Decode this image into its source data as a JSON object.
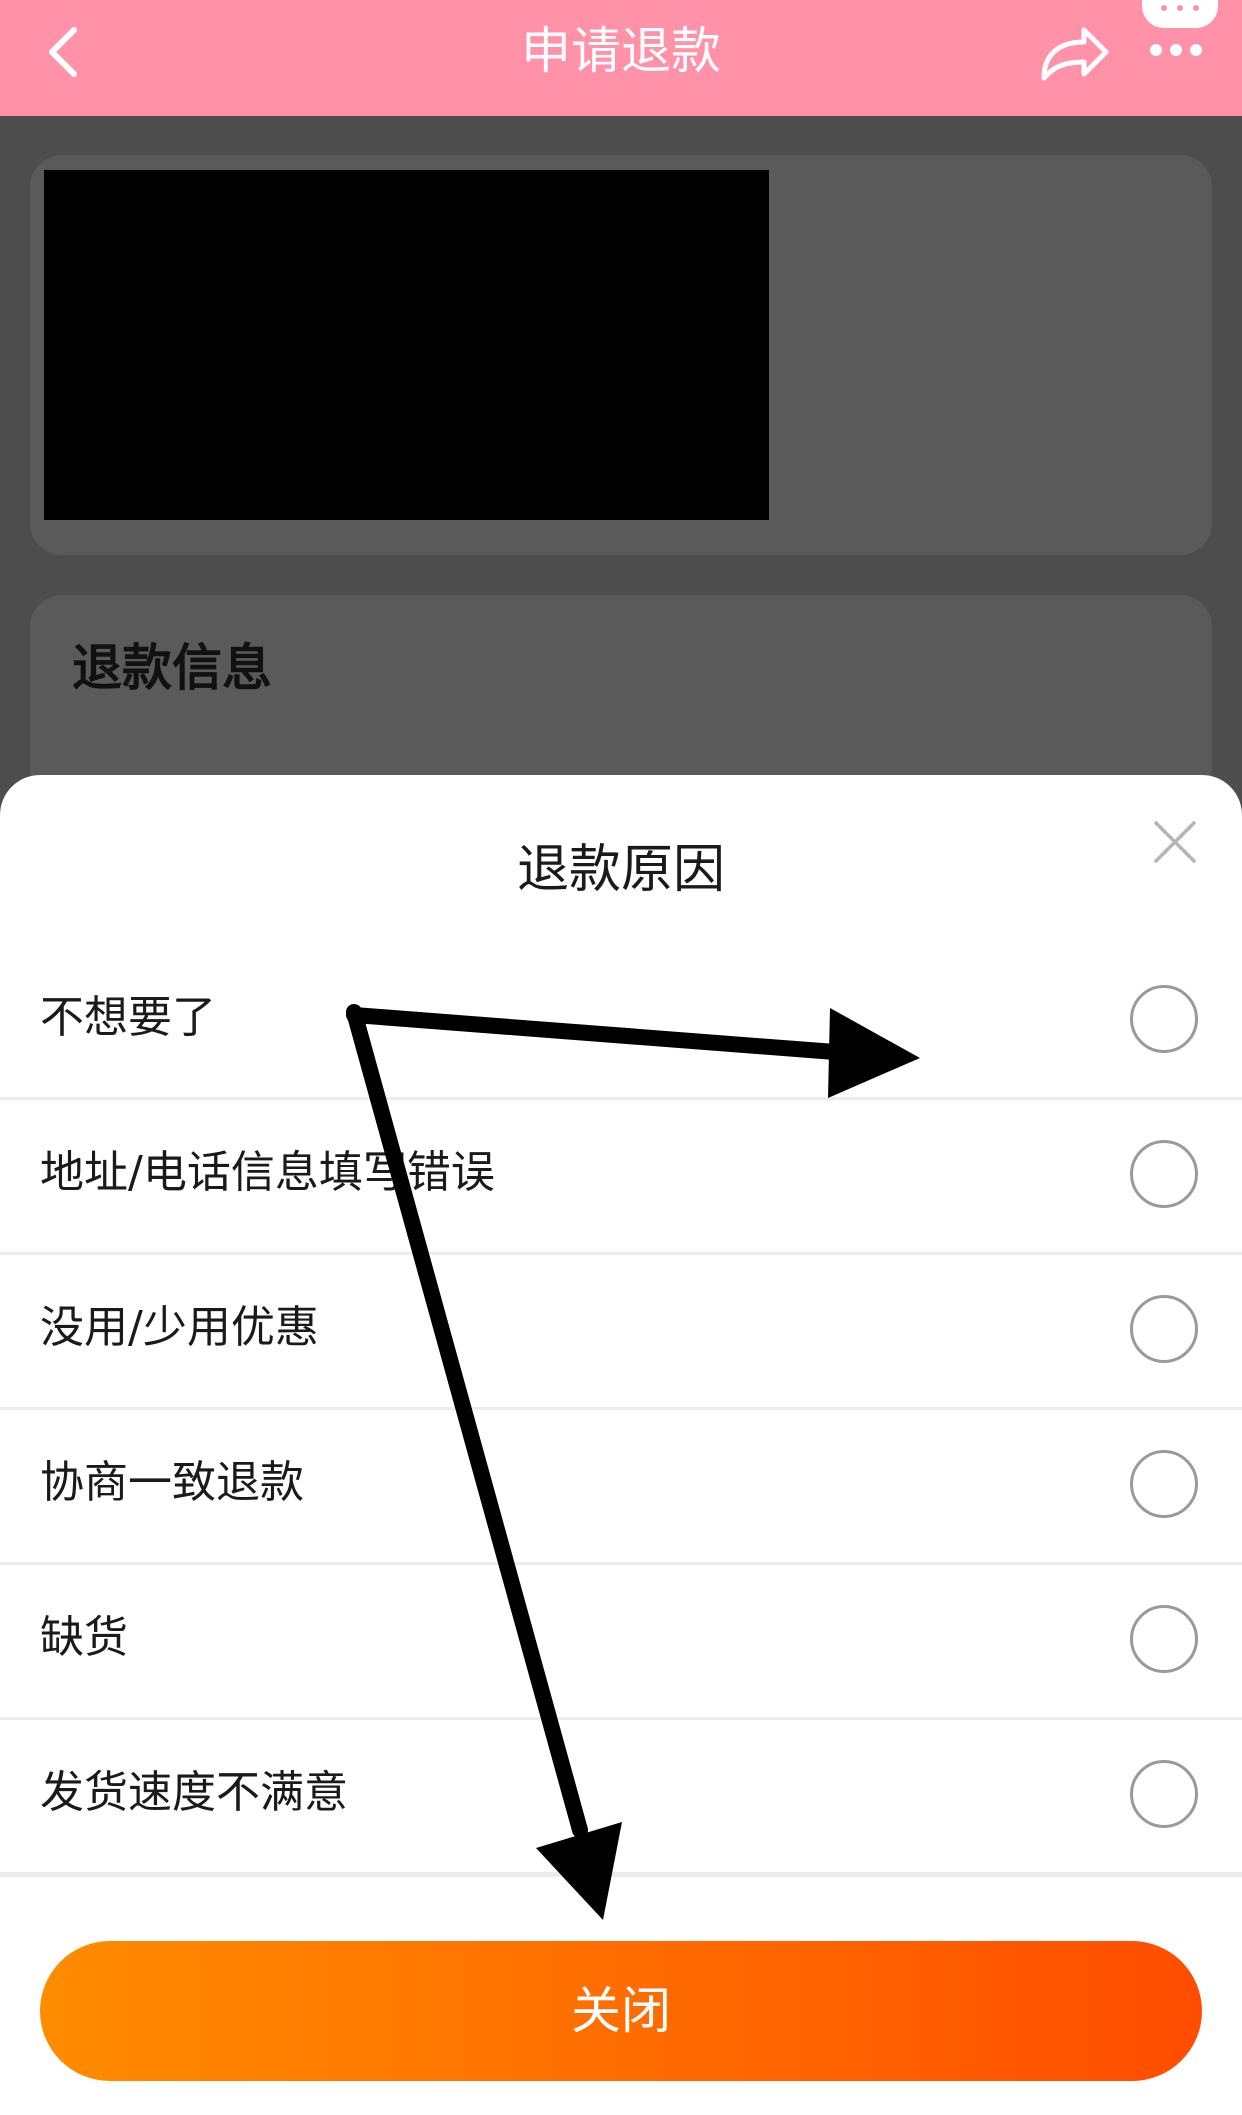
{
  "navbar": {
    "title": "申请退款",
    "back_icon": "chevron-left-icon",
    "share_icon": "share-icon",
    "more_icon": "more-icon",
    "bg_color": "#ff91a8"
  },
  "refund_info": {
    "title": "退款信息"
  },
  "sheet": {
    "title": "退款原因",
    "close_icon": "close-icon",
    "reasons": [
      {
        "label": "不想要了"
      },
      {
        "label": "地址/电话信息填写错误"
      },
      {
        "label": "没用/少用优惠"
      },
      {
        "label": "协商一致退款"
      },
      {
        "label": "缺货"
      },
      {
        "label": "发货速度不满意"
      }
    ],
    "close_button_label": "关闭",
    "button_gradient": [
      "#ff8c00",
      "#ff4d00"
    ]
  }
}
